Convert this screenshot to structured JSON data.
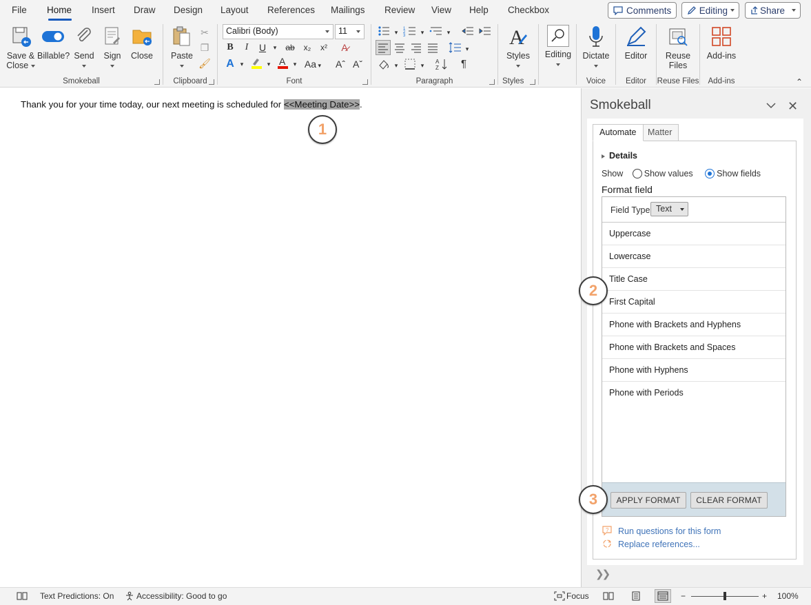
{
  "menu": {
    "tabs": [
      "File",
      "Home",
      "Insert",
      "Draw",
      "Design",
      "Layout",
      "References",
      "Mailings",
      "Review",
      "View",
      "Help",
      "Checkbox"
    ],
    "active_tab": "Home",
    "comments_label": "Comments",
    "editing_label": "Editing",
    "share_label": "Share"
  },
  "ribbon": {
    "smokeball": {
      "label": "Smokeball",
      "save_close": "Save &",
      "save_close2": "Close",
      "billable": "Billable?",
      "send": "Send",
      "sign": "Sign",
      "close": "Close"
    },
    "clipboard": {
      "label": "Clipboard",
      "paste": "Paste"
    },
    "font": {
      "label": "Font",
      "name": "Calibri (Body)",
      "size": "11",
      "bold": "B",
      "italic": "I",
      "underline": "U",
      "strike": "ab",
      "sub": "x₂",
      "sup": "x²",
      "case": "Aa",
      "grow": "Aˆ",
      "shrink": "Aˇ"
    },
    "paragraph": {
      "label": "Paragraph",
      "pilcrow": "¶"
    },
    "styles": {
      "label": "Styles",
      "button": "Styles"
    },
    "editing": {
      "button": "Editing"
    },
    "voice": {
      "label": "Voice",
      "button": "Dictate"
    },
    "editor": {
      "label": "Editor",
      "button": "Editor"
    },
    "reuse": {
      "label": "Reuse Files",
      "button": "Reuse",
      "button2": "Files"
    },
    "addins": {
      "label": "Add-ins",
      "button": "Add-ins"
    }
  },
  "document": {
    "text_before": "Thank you for your time today, our next meeting is scheduled for ",
    "field": "<<Meeting Date>>",
    "text_after": "."
  },
  "steps": [
    "1",
    "2",
    "3"
  ],
  "pane": {
    "title": "Smokeball",
    "tabs": [
      "Automate",
      "Matter"
    ],
    "details": "Details",
    "show_label": "Show",
    "show_values": "Show values",
    "show_fields": "Show fields",
    "selected_show": "Show fields",
    "format_field": "Format field",
    "field_type_label": "Field Type",
    "field_type_value": "Text",
    "format_options": [
      "Uppercase",
      "Lowercase",
      "Title Case",
      "First Capital",
      "Phone with Brackets and Hyphens",
      "Phone with Brackets and Spaces",
      "Phone with Hyphens",
      "Phone with Periods"
    ],
    "apply_format": "APPLY FORMAT",
    "clear_format": "CLEAR FORMAT",
    "run_questions": "Run questions for this form",
    "replace_refs": "Replace references..."
  },
  "status": {
    "text_predictions": "Text Predictions: On",
    "accessibility": "Accessibility: Good to go",
    "focus": "Focus",
    "zoom": "100%",
    "zoom_level": 1.0
  },
  "colors": {
    "accent": "#185abd",
    "link": "#3f73b8",
    "step_number": "#f2a26a",
    "field_highlight": "#a6a6a6",
    "format_footer": "#d3e0e8"
  }
}
